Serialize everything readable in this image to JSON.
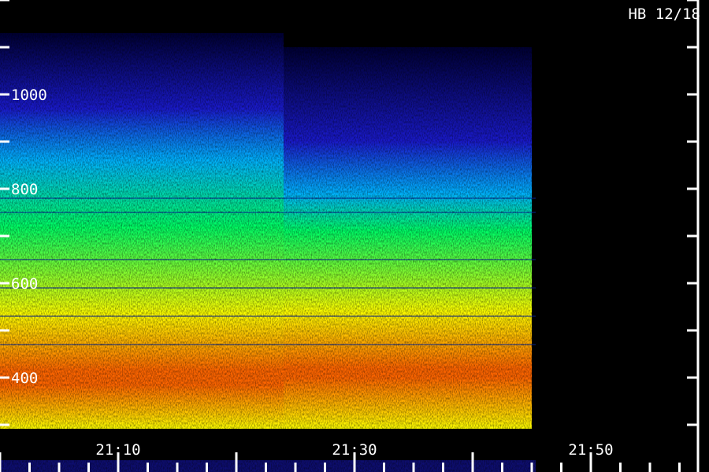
{
  "chart_data": {
    "type": "heatmap",
    "title": "HB 12/18",
    "xlabel": "",
    "ylabel": "",
    "x_tick_labels": [
      "21:10",
      "21:30",
      "21:50"
    ],
    "y_tick_labels": [
      "400",
      "600",
      "800",
      "1000"
    ],
    "ylim": [
      380,
      1140
    ],
    "colormap": [
      "#000033",
      "#1a1acc",
      "#00b4ff",
      "#00ff66",
      "#ffff00",
      "#ff6600"
    ],
    "segments": [
      {
        "start": "21:00",
        "end": "21:24",
        "green_top": 720,
        "cyan_top": 860,
        "blue_top": 970,
        "faint_top": 1130,
        "red_band": [
          385,
          415
        ]
      },
      {
        "start": "21:24",
        "end": "21:45",
        "green_top": 710,
        "cyan_top": 790,
        "blue_top": 900,
        "faint_top": 1100,
        "red_band": [
          400,
          420
        ]
      }
    ],
    "noise_lines": [
      780,
      750,
      650,
      590,
      530,
      470
    ]
  }
}
